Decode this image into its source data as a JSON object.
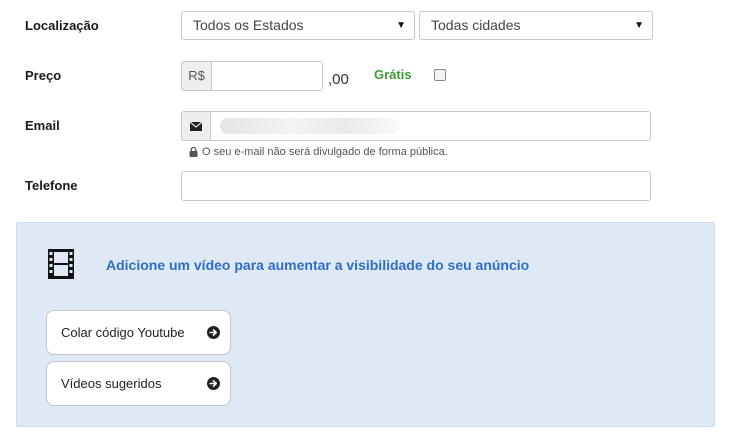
{
  "location": {
    "label": "Localização",
    "state_select": "Todos os Estados",
    "city_select": "Todas cidades"
  },
  "price": {
    "label": "Preço",
    "currency": "R$",
    "value": "",
    "cents_suffix": ",00",
    "free_label": "Grátis",
    "free_checked": false
  },
  "email": {
    "label": "Email",
    "value": "",
    "privacy_note": "O seu e-mail não será divulgado de forma pública."
  },
  "phone": {
    "label": "Telefone",
    "value": ""
  },
  "video": {
    "headline": "Adicione um vídeo para aumentar a visibilidade do seu anúncio",
    "buttons": [
      {
        "label": "Colar código Youtube",
        "icon": "arrow-right-circle-icon"
      },
      {
        "label": "Vídeos sugeridos",
        "icon": "arrow-right-circle-icon"
      }
    ]
  },
  "colors": {
    "accent_blue": "#2e6fc6",
    "free_green": "#3a9b35",
    "panel_bg": "#dfe8f5"
  }
}
